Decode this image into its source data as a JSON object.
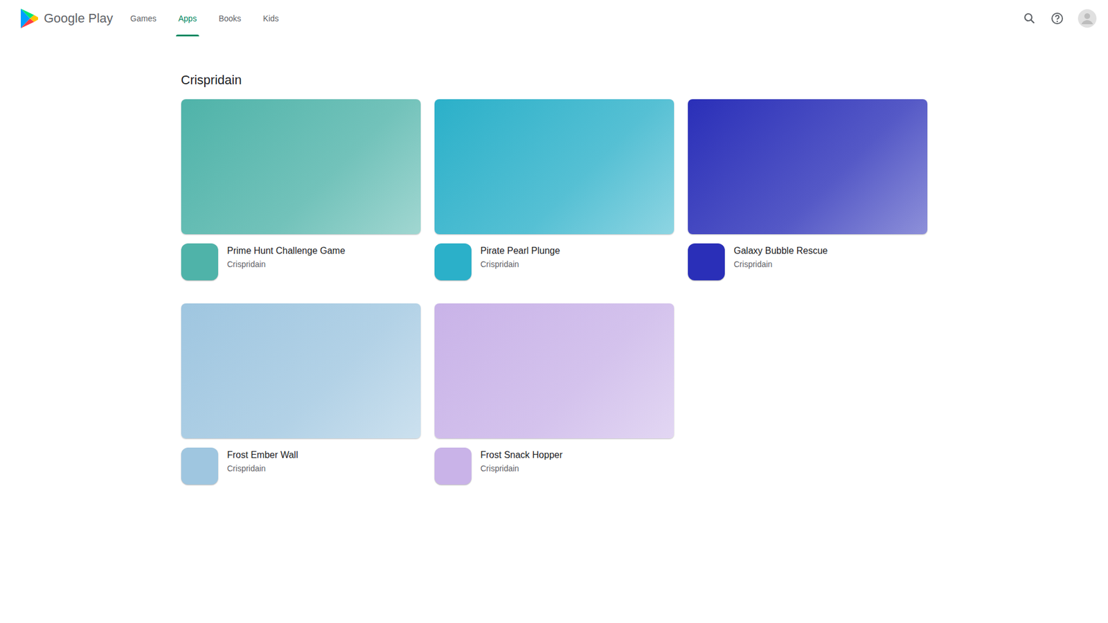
{
  "header": {
    "logo": "Google Play",
    "nav": [
      {
        "label": "Games",
        "selected": false
      },
      {
        "label": "Apps",
        "selected": true
      },
      {
        "label": "Books",
        "selected": false
      },
      {
        "label": "Kids",
        "selected": false
      }
    ]
  },
  "section": {
    "title": "Crispridain"
  },
  "apps": [
    {
      "name": "Prime Hunt Challenge Game",
      "developer": "Crispridain",
      "color": "#4fb3a9"
    },
    {
      "name": "Pirate Pearl Plunge",
      "developer": "Crispridain",
      "color": "#2bb0c9"
    },
    {
      "name": "Galaxy Bubble Rescue",
      "developer": "Crispridain",
      "color": "#2a2fb8"
    },
    {
      "name": "Frost Ember Wall",
      "developer": "Crispridain",
      "color": "#9fc6e0"
    },
    {
      "name": "Frost Snack Hopper",
      "developer": "Crispridain",
      "color": "#c9b3e8"
    }
  ]
}
